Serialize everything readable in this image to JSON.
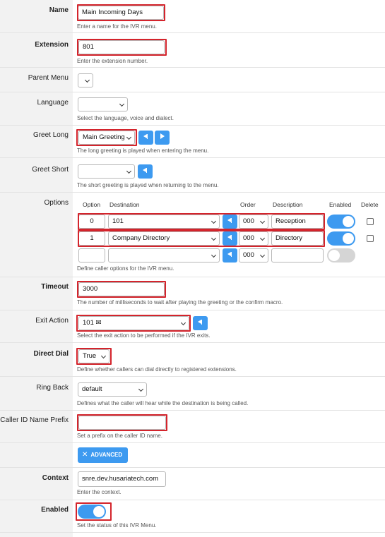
{
  "fields": {
    "name": {
      "label": "Name",
      "value": "Main Incoming Days",
      "hint": "Enter a name for the IVR menu."
    },
    "extension": {
      "label": "Extension",
      "value": "801",
      "hint": "Enter the extension number."
    },
    "parent_menu": {
      "label": "Parent Menu",
      "value": ""
    },
    "language": {
      "label": "Language",
      "value": "",
      "hint": "Select the language, voice and dialect."
    },
    "greet_long": {
      "label": "Greet Long",
      "value": "Main Greeting",
      "hint": "The long greeting is played when entering the menu."
    },
    "greet_short": {
      "label": "Greet Short",
      "value": "",
      "hint": "The short greeting is played when returning to the menu."
    },
    "options": {
      "label": "Options",
      "headers": {
        "option": "Option",
        "destination": "Destination",
        "order": "Order",
        "description": "Description",
        "enabled": "Enabled",
        "delete": "Delete"
      },
      "rows": [
        {
          "option": "0",
          "destination": "101",
          "order": "000",
          "description": "Reception",
          "enabled": true
        },
        {
          "option": "1",
          "destination": "Company Directory",
          "order": "000",
          "description": "Directory",
          "enabled": true
        },
        {
          "option": "",
          "destination": "",
          "order": "000",
          "description": "",
          "enabled": false
        }
      ],
      "hint": "Define caller options for the IVR menu."
    },
    "timeout": {
      "label": "Timeout",
      "value": "3000",
      "hint": "The number of milliseconds to wait after playing the greeting or the confirm macro."
    },
    "exit_action": {
      "label": "Exit Action",
      "value": "101 ✉",
      "hint": "Select the exit action to be performed if the IVR exits."
    },
    "direct_dial": {
      "label": "Direct Dial",
      "value": "True",
      "hint": "Define whether callers can dial directly to registered extensions."
    },
    "ring_back": {
      "label": "Ring Back",
      "value": "default",
      "hint": "Defines what the caller will hear while the destination is being called."
    },
    "caller_id_prefix": {
      "label": "Caller ID Name Prefix",
      "value": "",
      "hint": "Set a prefix on the caller ID name."
    },
    "advanced_button": {
      "label": "ADVANCED"
    },
    "context": {
      "label": "Context",
      "value": "snre.dev.husariatech.com",
      "hint": "Enter the context."
    },
    "enabled": {
      "label": "Enabled",
      "value": true,
      "hint": "Set the status of this IVR Menu."
    }
  },
  "colors": {
    "accent": "#3d9af0",
    "highlight": "#d4242c",
    "label_bg": "#f2f2f2"
  },
  "icons": {
    "select_back": "back-triangle-icon",
    "play": "play-icon",
    "advanced": "wrench-icon"
  }
}
